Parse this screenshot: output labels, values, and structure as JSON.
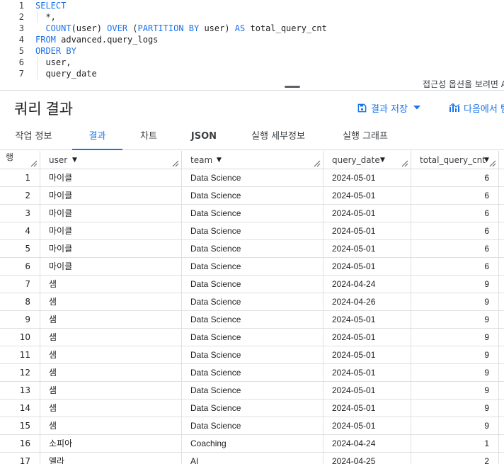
{
  "editor": {
    "lines": [
      {
        "num": "1",
        "tokens": [
          {
            "t": "SELECT",
            "c": "kw"
          }
        ]
      },
      {
        "num": "2",
        "tokens": [
          {
            "t": "  *,",
            "c": ""
          }
        ]
      },
      {
        "num": "3",
        "tokens": [
          {
            "t": "  ",
            "c": ""
          },
          {
            "t": "COUNT",
            "c": "kw"
          },
          {
            "t": "(user) ",
            "c": ""
          },
          {
            "t": "OVER",
            "c": "kw"
          },
          {
            "t": " (",
            "c": ""
          },
          {
            "t": "PARTITION BY",
            "c": "kw"
          },
          {
            "t": " user) ",
            "c": ""
          },
          {
            "t": "AS",
            "c": "kw"
          },
          {
            "t": " total_query_cnt",
            "c": ""
          }
        ]
      },
      {
        "num": "4",
        "tokens": [
          {
            "t": "FROM",
            "c": "kw"
          },
          {
            "t": " advanced.query_logs",
            "c": ""
          }
        ]
      },
      {
        "num": "5",
        "tokens": [
          {
            "t": "ORDER BY",
            "c": "kw"
          }
        ]
      },
      {
        "num": "6",
        "tokens": [
          {
            "t": "  user,",
            "c": ""
          }
        ]
      },
      {
        "num": "7",
        "tokens": [
          {
            "t": "  query_date",
            "c": ""
          }
        ]
      }
    ],
    "accessibility_hint": "접근성 옵션을 보려면 A"
  },
  "results": {
    "title": "쿼리 결과",
    "save_label": "결과 저장",
    "explore_label": "다음에서 탐"
  },
  "tabs": [
    {
      "label": "작업 정보",
      "active": false
    },
    {
      "label": "결과",
      "active": true
    },
    {
      "label": "차트",
      "active": false
    },
    {
      "label": "JSON",
      "active": false
    },
    {
      "label": "실행 세부정보",
      "active": false
    },
    {
      "label": "실행 그래프",
      "active": false
    }
  ],
  "table": {
    "columns": {
      "index": "행",
      "user": "user",
      "team": "team",
      "query_date": "query_date",
      "total_query_cnt": "total_query_cnt"
    },
    "rows": [
      {
        "idx": "1",
        "user": "마이클",
        "team": "Data Science",
        "date": "2024-05-01",
        "cnt": "6"
      },
      {
        "idx": "2",
        "user": "마이클",
        "team": "Data Science",
        "date": "2024-05-01",
        "cnt": "6"
      },
      {
        "idx": "3",
        "user": "마이클",
        "team": "Data Science",
        "date": "2024-05-01",
        "cnt": "6"
      },
      {
        "idx": "4",
        "user": "마이클",
        "team": "Data Science",
        "date": "2024-05-01",
        "cnt": "6"
      },
      {
        "idx": "5",
        "user": "마이클",
        "team": "Data Science",
        "date": "2024-05-01",
        "cnt": "6"
      },
      {
        "idx": "6",
        "user": "마이클",
        "team": "Data Science",
        "date": "2024-05-01",
        "cnt": "6"
      },
      {
        "idx": "7",
        "user": "샘",
        "team": "Data Science",
        "date": "2024-04-24",
        "cnt": "9"
      },
      {
        "idx": "8",
        "user": "샘",
        "team": "Data Science",
        "date": "2024-04-26",
        "cnt": "9"
      },
      {
        "idx": "9",
        "user": "샘",
        "team": "Data Science",
        "date": "2024-05-01",
        "cnt": "9"
      },
      {
        "idx": "10",
        "user": "샘",
        "team": "Data Science",
        "date": "2024-05-01",
        "cnt": "9"
      },
      {
        "idx": "11",
        "user": "샘",
        "team": "Data Science",
        "date": "2024-05-01",
        "cnt": "9"
      },
      {
        "idx": "12",
        "user": "샘",
        "team": "Data Science",
        "date": "2024-05-01",
        "cnt": "9"
      },
      {
        "idx": "13",
        "user": "샘",
        "team": "Data Science",
        "date": "2024-05-01",
        "cnt": "9"
      },
      {
        "idx": "14",
        "user": "샘",
        "team": "Data Science",
        "date": "2024-05-01",
        "cnt": "9"
      },
      {
        "idx": "15",
        "user": "샘",
        "team": "Data Science",
        "date": "2024-05-01",
        "cnt": "9"
      },
      {
        "idx": "16",
        "user": "소피아",
        "team": "Coaching",
        "date": "2024-04-24",
        "cnt": "1"
      },
      {
        "idx": "17",
        "user": "엘라",
        "team": "AI",
        "date": "2024-04-25",
        "cnt": "2"
      }
    ]
  },
  "colors": {
    "accent": "#1a73e8",
    "keyword": "#1a73e8",
    "border": "#dadce0"
  }
}
